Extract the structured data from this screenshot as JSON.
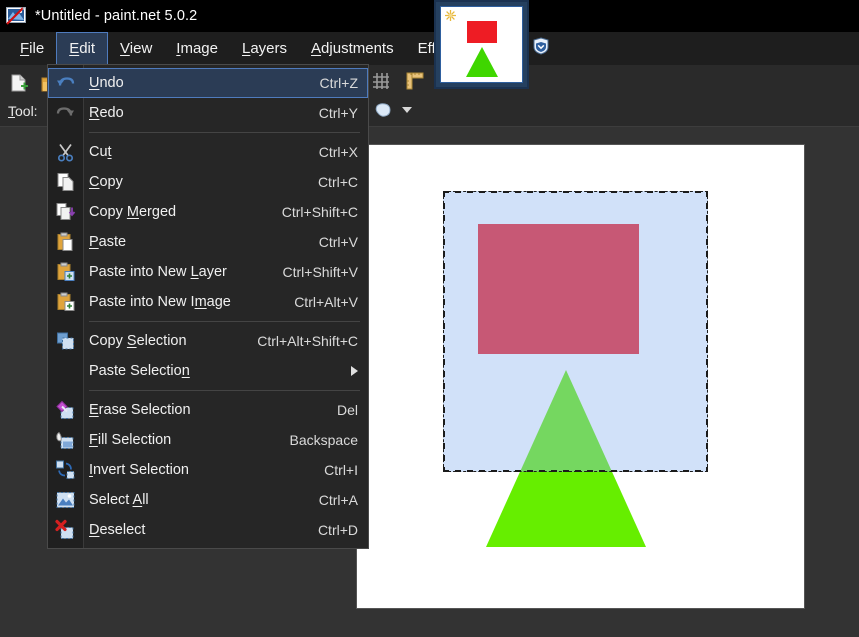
{
  "window": {
    "title": "*Untitled - paint.net 5.0.2",
    "app_icon": "paintnet-icon"
  },
  "menubar": {
    "items": [
      {
        "label": "File",
        "accel": "F",
        "active": false
      },
      {
        "label": "Edit",
        "accel": "E",
        "active": true
      },
      {
        "label": "View",
        "accel": "V",
        "active": false
      },
      {
        "label": "Image",
        "accel": "I",
        "active": false
      },
      {
        "label": "Layers",
        "accel": "L",
        "active": false
      },
      {
        "label": "Adjustments",
        "accel": "A",
        "active": false
      },
      {
        "label": "Effects",
        "accel": "c",
        "active": false
      }
    ]
  },
  "toolbar": {
    "tool_label": "Tool:",
    "tool_accel": "T",
    "icons": [
      "new-file-icon",
      "open-folder-icon",
      "grid-icon",
      "ruler-icon",
      "shape-blob-icon",
      "chevron-down-icon"
    ]
  },
  "thumbnail_panel": {
    "star_icon": "sparkle-icon",
    "shield_icon": "shield-icon"
  },
  "edit_menu": {
    "items": [
      {
        "kind": "item",
        "icon": "undo-icon",
        "label": "Undo",
        "accel": "U",
        "shortcut": "Ctrl+Z",
        "highlight": true
      },
      {
        "kind": "item",
        "icon": "redo-icon",
        "label": "Redo",
        "accel": "R",
        "shortcut": "Ctrl+Y",
        "highlight": false
      },
      {
        "kind": "separator"
      },
      {
        "kind": "item",
        "icon": "cut-scissors-icon",
        "label": "Cut",
        "accel": "t",
        "shortcut": "Ctrl+X",
        "highlight": false
      },
      {
        "kind": "item",
        "icon": "copy-icon",
        "label": "Copy",
        "accel": "C",
        "shortcut": "Ctrl+C",
        "highlight": false
      },
      {
        "kind": "item",
        "icon": "copy-merged-icon",
        "label": "Copy Merged",
        "accel": "M",
        "shortcut": "Ctrl+Shift+C",
        "highlight": false
      },
      {
        "kind": "item",
        "icon": "paste-icon",
        "label": "Paste",
        "accel": "P",
        "shortcut": "Ctrl+V",
        "highlight": false
      },
      {
        "kind": "item",
        "icon": "paste-new-layer-icon",
        "label": "Paste into New Layer",
        "accel": "L",
        "shortcut": "Ctrl+Shift+V",
        "highlight": false
      },
      {
        "kind": "item",
        "icon": "paste-new-image-icon",
        "label": "Paste into New Image",
        "accel": "m",
        "shortcut": "Ctrl+Alt+V",
        "highlight": false
      },
      {
        "kind": "separator"
      },
      {
        "kind": "item",
        "icon": "copy-selection-icon",
        "label": "Copy Selection",
        "accel": "S",
        "shortcut": "Ctrl+Alt+Shift+C",
        "highlight": false
      },
      {
        "kind": "item",
        "icon": "none",
        "label": "Paste Selection",
        "accel": "n",
        "shortcut": "",
        "submenu": true,
        "highlight": false
      },
      {
        "kind": "separator"
      },
      {
        "kind": "item",
        "icon": "erase-selection-icon",
        "label": "Erase Selection",
        "accel": "E",
        "shortcut": "Del",
        "highlight": false
      },
      {
        "kind": "item",
        "icon": "fill-selection-icon",
        "label": "Fill Selection",
        "accel": "F",
        "shortcut": "Backspace",
        "highlight": false
      },
      {
        "kind": "item",
        "icon": "invert-selection-icon",
        "label": "Invert Selection",
        "accel": "I",
        "shortcut": "Ctrl+I",
        "highlight": false
      },
      {
        "kind": "item",
        "icon": "select-all-icon",
        "label": "Select All",
        "accel": "A",
        "shortcut": "Ctrl+A",
        "highlight": false
      },
      {
        "kind": "item",
        "icon": "deselect-icon",
        "label": "Deselect",
        "accel": "D",
        "shortcut": "Ctrl+D",
        "highlight": false
      }
    ]
  },
  "canvas": {
    "background_color": "#ffffff",
    "shapes": [
      {
        "name": "red-rectangle",
        "type": "rectangle",
        "color": "#ee1c24"
      },
      {
        "name": "green-triangle",
        "type": "triangle",
        "color": "#66ee00"
      }
    ],
    "selection": {
      "name": "rectangle-selection",
      "border_style": "marching-ants-dashed",
      "tint_color": "#8cb4f0"
    }
  },
  "colors": {
    "titlebar_bg": "#000000",
    "menubar_bg": "#1e1e1e",
    "toolbar_bg": "#2a2a2a",
    "workspace_bg": "#333333",
    "menu_bg": "#262626",
    "highlight_bg": "#2b3c55",
    "highlight_border": "#4f7bbd",
    "accel_underline": "#f0f0f0"
  }
}
